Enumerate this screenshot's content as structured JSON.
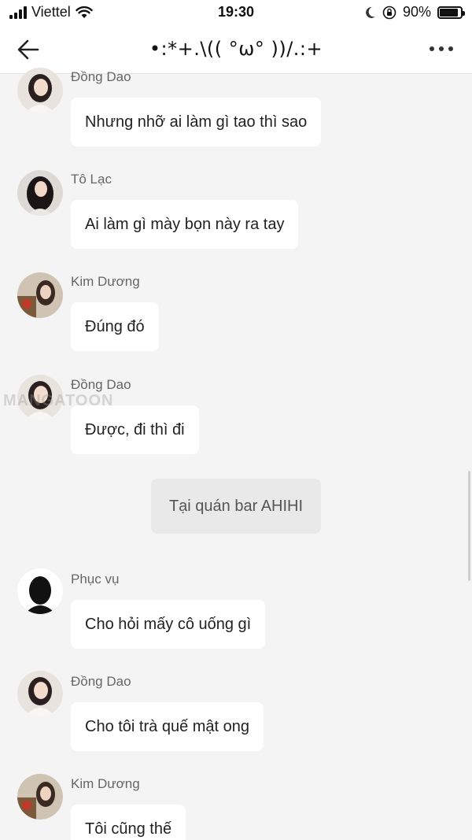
{
  "status_bar": {
    "carrier": "Viettel",
    "time": "19:30",
    "battery": "90%",
    "battery_level": 0.9
  },
  "header": {
    "title": "•:*+.\\(( °ω° ))/.:+",
    "back_icon": "arrow-left-icon",
    "more_icon": "more-horizontal-icon"
  },
  "watermark": "MANGATOON",
  "messages": [
    {
      "sender": "Đồng Dao",
      "text": "Nhưng nhỡ ai làm gì tao thì sao"
    },
    {
      "sender": "Tô Lạc",
      "text": "Ai làm gì mày bọn này ra tay"
    },
    {
      "sender": "Kim Dương",
      "text": "Đúng đó"
    },
    {
      "sender": "Đồng Dao",
      "text": "Được, đi thì đi"
    },
    {
      "sender": "Phục vụ",
      "text": "Cho hỏi mấy cô uống gì"
    },
    {
      "sender": "Đồng Dao",
      "text": "Cho tôi trà quế mật ong"
    },
    {
      "sender": "Kim Dương",
      "text": "Tôi cũng thế"
    }
  ],
  "system_message": "Tại quán bar AHIHI"
}
